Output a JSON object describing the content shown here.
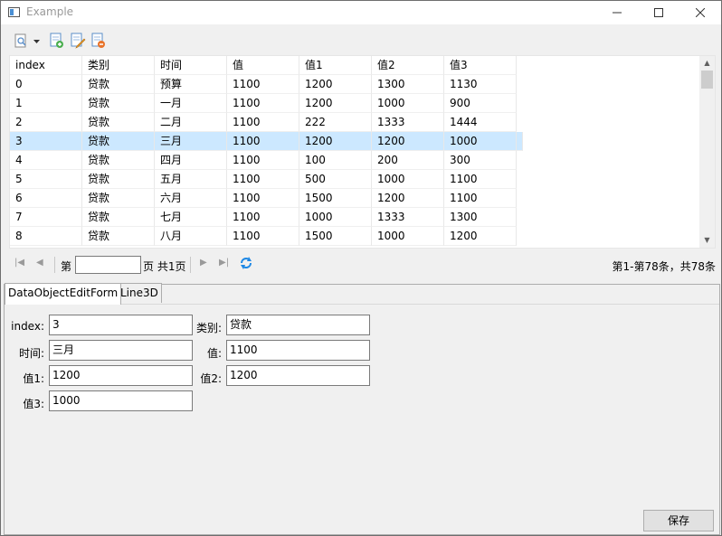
{
  "window": {
    "title": "Example"
  },
  "grid": {
    "columns": [
      "index",
      "类别",
      "时间",
      "值",
      "值1",
      "值2",
      "值3"
    ],
    "rows": [
      [
        "0",
        "贷款",
        "预算",
        "1100",
        "1200",
        "1300",
        "1130"
      ],
      [
        "1",
        "贷款",
        "一月",
        "1100",
        "1200",
        "1000",
        "900"
      ],
      [
        "2",
        "贷款",
        "二月",
        "1100",
        "222",
        "1333",
        "1444"
      ],
      [
        "3",
        "贷款",
        "三月",
        "1100",
        "1200",
        "1200",
        "1000"
      ],
      [
        "4",
        "贷款",
        "四月",
        "1100",
        "100",
        "200",
        "300"
      ],
      [
        "5",
        "贷款",
        "五月",
        "1100",
        "500",
        "1000",
        "1100"
      ],
      [
        "6",
        "贷款",
        "六月",
        "1100",
        "1500",
        "1200",
        "1100"
      ],
      [
        "7",
        "贷款",
        "七月",
        "1100",
        "1000",
        "1333",
        "1300"
      ],
      [
        "8",
        "贷款",
        "八月",
        "1100",
        "1500",
        "1000",
        "1200"
      ]
    ],
    "selected_row": 3
  },
  "pager": {
    "page_prefix": "第",
    "page_value": "",
    "page_suffix": "页 共1页",
    "summary": "第1-第78条，共78条"
  },
  "tabs": [
    "DataObjectEditForm",
    "Line3D"
  ],
  "form": {
    "index_label": "index:",
    "index_value": "3",
    "category_label": "类别:",
    "category_value": "贷款",
    "time_label": "时间:",
    "time_value": "三月",
    "value_label": "值:",
    "value_value": "1100",
    "value1_label": "值1:",
    "value1_value": "1200",
    "value2_label": "值2:",
    "value2_value": "1200",
    "value3_label": "值3:",
    "value3_value": "1000",
    "save_label": "保存"
  }
}
